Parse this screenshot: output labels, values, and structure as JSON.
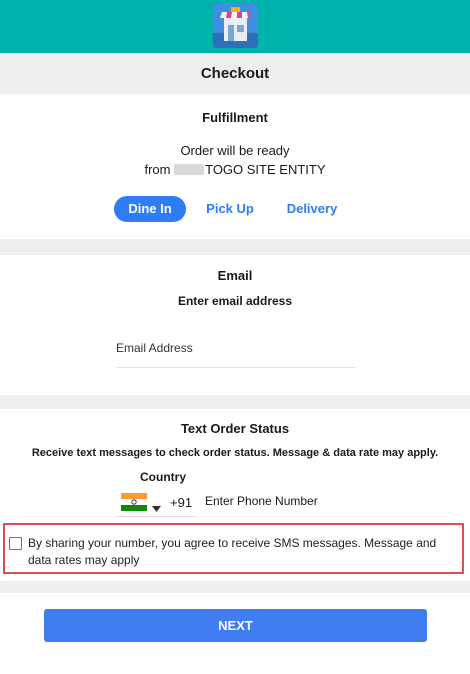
{
  "header": {
    "title": "Checkout"
  },
  "fulfillment": {
    "heading": "Fulfillment",
    "ready_line": "Order will be ready",
    "from_prefix": "from",
    "site_name": "TOGO SITE ENTITY",
    "options": [
      {
        "label": "Dine In",
        "active": true
      },
      {
        "label": "Pick Up",
        "active": false
      },
      {
        "label": "Delivery",
        "active": false
      }
    ]
  },
  "email": {
    "heading": "Email",
    "subheading": "Enter email address",
    "placeholder": "Email Address"
  },
  "text_status": {
    "heading": "Text Order Status",
    "description": "Receive text messages to check order status. Message & data rate may apply.",
    "country_label": "Country",
    "country_code": "+91",
    "phone_placeholder": "Enter Phone Number",
    "flag_icon": "india-flag-icon"
  },
  "consent": {
    "checked": false,
    "text": "By sharing your number, you agree to receive SMS messages. Message and data rates may apply"
  },
  "footer": {
    "next_label": "NEXT"
  },
  "colors": {
    "teal": "#00b3aa",
    "accent_blue": "#2f7cf6",
    "highlight_red": "#d9534f"
  }
}
